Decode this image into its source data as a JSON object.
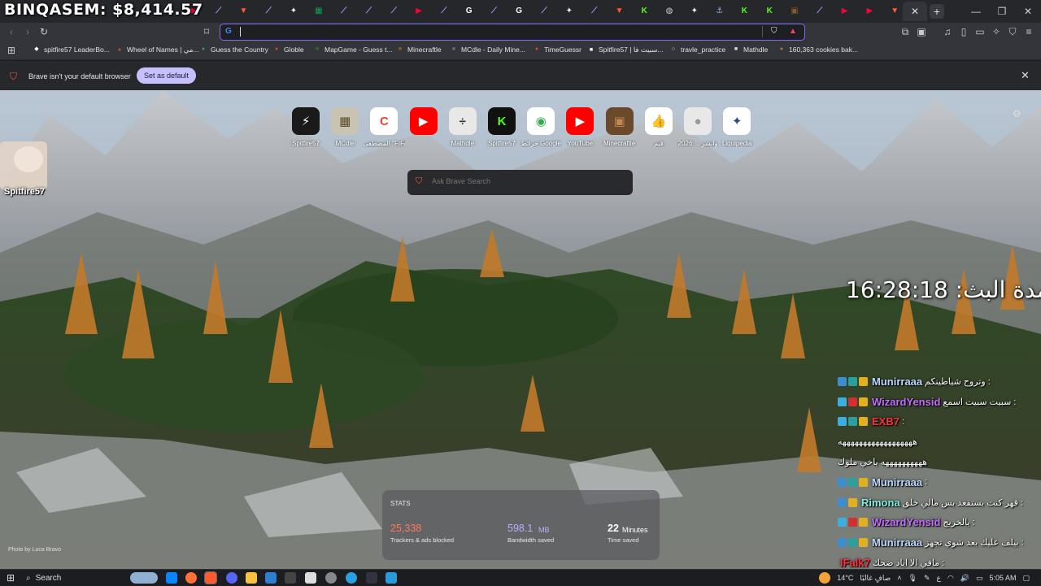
{
  "overlay": {
    "stream_title": "BINQASEM: $8,414.57",
    "streamer_name": "Spitfire57",
    "uptime": "مدة البث: 16:28:18"
  },
  "tabs": {
    "icons": [
      "feather-icon",
      "youtube-icon",
      "feather-icon",
      "brave-icon",
      "feather-icon",
      "notion-icon",
      "sheets-icon",
      "feather-icon",
      "feather-icon",
      "feather-icon",
      "youtube-icon",
      "feather-icon",
      "google-icon",
      "feather-icon",
      "google-icon",
      "feather-icon",
      "notion-icon",
      "feather-icon",
      "brave-icon",
      "kick-icon",
      "globe-icon",
      "notion-icon",
      "anchor-icon",
      "kick-icon",
      "kick-icon",
      "minecraft-icon",
      "feather-icon",
      "youtube-icon",
      "youtube-icon",
      "brave-icon"
    ],
    "active_close": "✕",
    "new_tab": "+"
  },
  "toolbar": {
    "omnibox_value": "",
    "omnibox_icon": "G"
  },
  "bookmarks": [
    {
      "label": "spitfire57 LeaderBo...",
      "icon": "◆",
      "color": "#ffffff"
    },
    {
      "label": "Wheel of Names | مي...",
      "icon": "●",
      "color": "#e04040"
    },
    {
      "label": "Guess the Country",
      "icon": "●",
      "color": "#30a050"
    },
    {
      "label": "Globle",
      "icon": "●",
      "color": "#d04040"
    },
    {
      "label": "MapGame - Guess t...",
      "icon": "■",
      "color": "#2f6b2f"
    },
    {
      "label": "Minecraftle",
      "icon": "■",
      "color": "#8b5a2b"
    },
    {
      "label": "MCdle - Daily Mine...",
      "icon": "■",
      "color": "#6a6a6a"
    },
    {
      "label": "TimeGuessr",
      "icon": "●",
      "color": "#e04040"
    },
    {
      "label": "Spitfire57 | سبيت فا...",
      "icon": "■",
      "color": "#ffffff"
    },
    {
      "label": "travle_practice",
      "icon": "○",
      "color": "#dddddd"
    },
    {
      "label": "Mathdle",
      "icon": "■",
      "color": "#dddddd"
    },
    {
      "label": "160,363 cookies bak...",
      "icon": "●",
      "color": "#b07a3a"
    }
  ],
  "infobar": {
    "message": "Brave isn't your default browser",
    "button": "Set as default"
  },
  "shortcuts": [
    {
      "label": "Spitfire57",
      "glyph": "⚡",
      "bg": "#1a1a1a",
      "fg": "#ffffff"
    },
    {
      "label": "MCdle",
      "glyph": "▦",
      "bg": "#c9c3b3",
      "fg": "#5a4a2a"
    },
    {
      "label": "المصطفى \"FIFAe Worl...",
      "glyph": "C",
      "bg": "#ffffff",
      "fg": "#ea4335"
    },
    {
      "label": "",
      "glyph": "▶",
      "bg": "#ff0000",
      "fg": "#ffffff"
    },
    {
      "label": "Mathdle",
      "glyph": "÷",
      "bg": "#e8e8e8",
      "fg": "#333333"
    },
    {
      "label": "Spitfire57",
      "glyph": "K",
      "bg": "#111111",
      "fg": "#53fc18"
    },
    {
      "label": "خرائط Google",
      "glyph": "◉",
      "bg": "#ffffff",
      "fg": "#34a853"
    },
    {
      "label": "YouTube",
      "glyph": "▶",
      "bg": "#ff0000",
      "fg": "#ffffff"
    },
    {
      "label": "Minecraftle",
      "glyph": "▣",
      "bg": "#6b4a2b",
      "fg": "#c08a50"
    },
    {
      "label": "قيم",
      "glyph": "👍",
      "bg": "#ffffff",
      "fg": "#2f6fe0"
    },
    {
      "label": "2026 ... وانشر",
      "glyph": "●",
      "bg": "#e8e8e8",
      "fg": "#999999"
    },
    {
      "label": "Liquipedia",
      "glyph": "✦",
      "bg": "#ffffff",
      "fg": "#2a4a8a"
    }
  ],
  "search": {
    "placeholder": "Ask Brave Search"
  },
  "chat": [
    {
      "name": "Munirraaa",
      "color": "#bcd8ff",
      "msg": "وتروح شياطينكم :",
      "badges": [
        "#3b8fd0",
        "#2aa0a0",
        "#e0b020"
      ]
    },
    {
      "name": "WizardYensid",
      "color": "#c46cff",
      "msg": "سبيت سبيت اسمع :",
      "badges": [
        "#3bb0e0",
        "#d03030",
        "#e0b020"
      ]
    },
    {
      "name": "EXB7",
      "color": "#ff3040",
      "msg": ":",
      "badges": [
        "#3bb0e0",
        "#2aa0a0",
        "#e0b020"
      ]
    },
    {
      "name": "",
      "color": "#ffffff",
      "msg": "ههههههههههههههههههه",
      "badges": []
    },
    {
      "name": "",
      "color": "#ffffff",
      "msg": "ههههههههههه ياخي ملوك",
      "badges": []
    },
    {
      "name": "Munirraaa",
      "color": "#bcd8ff",
      "msg": ":",
      "badges": [
        "#3b8fd0",
        "#2aa0a0",
        "#e0b020"
      ]
    },
    {
      "name": "Rimona",
      "color": "#7ff0e0",
      "msg": "قهر كنت بستقعد بس مالي خلق :",
      "badges": [
        "#3b8fd0",
        "#e0b020"
      ]
    },
    {
      "name": "WizardYensid",
      "color": "#c46cff",
      "msg": "يالخريج :",
      "badges": [
        "#3bb0e0",
        "#d03030",
        "#e0b020"
      ]
    },
    {
      "name": "Munirraaa",
      "color": "#bcd8ff",
      "msg": "بيلف عليك بعد شوي تجهز :",
      "badges": [
        "#3b8fd0",
        "#2aa0a0",
        "#e0b020"
      ]
    },
    {
      "name": "lFalk7",
      "color": "#ff3040",
      "msg": "مافي الا اياد ضحك :",
      "badges": []
    }
  ],
  "stats": {
    "heading": "STATS",
    "trackers_value": "25,338",
    "trackers_label": "Trackers & ads blocked",
    "bandwidth_value": "598.1",
    "bandwidth_unit": "MB",
    "bandwidth_label": "Bandwidth saved",
    "time_value": "22",
    "time_unit": "Minutes",
    "time_label": "Time saved"
  },
  "photo_credit": "Photo by Luca Bravo",
  "taskbar": {
    "search_label": "Search",
    "weather": "14°C",
    "weather_desc": "صافٍ غالبًا",
    "lang": "ع",
    "time": "5:05 AM"
  }
}
